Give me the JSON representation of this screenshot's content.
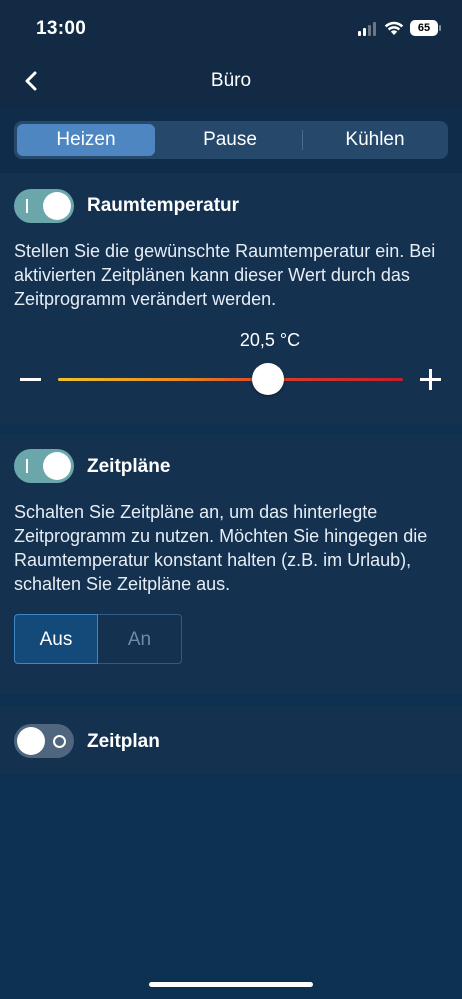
{
  "status_bar": {
    "time": "13:00",
    "battery": "65"
  },
  "nav": {
    "title": "Büro",
    "back_icon": "chevron-left-icon"
  },
  "mode_tabs": [
    {
      "label": "Heizen",
      "active": true
    },
    {
      "label": "Pause",
      "active": false
    },
    {
      "label": "Kühlen",
      "active": false
    }
  ],
  "room_temperature": {
    "title": "Raumtemperatur",
    "toggle_on": true,
    "description": "Stellen Sie die gewünschte Raumtemperatur ein. Bei aktivierten Zeitplänen kann dieser Wert durch das Zeitprogramm verändert werden.",
    "value_label": "20,5 °C",
    "slider_fraction": 0.61
  },
  "schedules": {
    "title": "Zeitpläne",
    "toggle_on": true,
    "description": "Schalten Sie Zeitpläne an, um das hinterlegte Zeitprogramm zu nutzen. Möchten Sie hingegen die Raumtemperatur konstant halten (z.B. im Urlaub), schalten Sie Zeitpläne aus.",
    "options": [
      {
        "label": "Aus",
        "selected": true
      },
      {
        "label": "An",
        "selected": false
      }
    ]
  },
  "schedule": {
    "title": "Zeitplan",
    "toggle_on": false
  },
  "colors": {
    "background": "#0d3150",
    "card": "#153150",
    "accent": "#4d86c1",
    "toggle_on": "#6ba7aa"
  }
}
